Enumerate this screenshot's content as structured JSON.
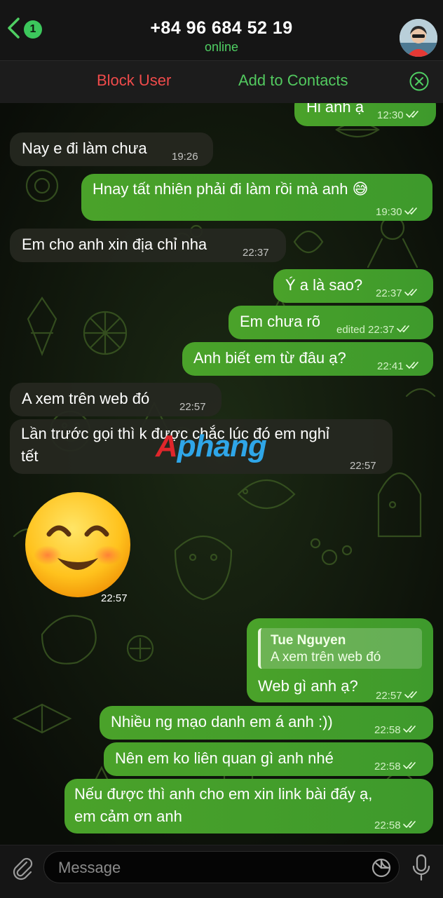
{
  "header": {
    "back_badge": "1",
    "title": "+84 96 684 52 19",
    "status": "online"
  },
  "action_bar": {
    "block": "Block User",
    "add": "Add to Contacts"
  },
  "messages": [
    {
      "text": "Hi anh ạ",
      "time": "12:30",
      "dir": "out"
    },
    {
      "text": "Nay e đi làm chưa",
      "time": "19:26",
      "dir": "in"
    },
    {
      "text": "Hnay tất nhiên phải đi làm rồi mà anh 😅",
      "time": "19:30",
      "dir": "out"
    },
    {
      "text": "Em cho anh xin địa chỉ nha",
      "time": "22:37",
      "dir": "in"
    },
    {
      "text": "Ý a là sao?",
      "time": "22:37",
      "dir": "out"
    },
    {
      "text": "Em chưa rõ",
      "edited": "edited",
      "time": "22:37",
      "dir": "out"
    },
    {
      "text": "Anh biết em từ đâu ạ?",
      "time": "22:41",
      "dir": "out"
    },
    {
      "text": "A xem trên web đó",
      "time": "22:57",
      "dir": "in"
    },
    {
      "line1": "Lần trước gọi thì k được chắc lúc đó em nghỉ",
      "line2": "tết",
      "time": "22:57",
      "dir": "in"
    },
    {
      "emoji": "smiling-face-emoji",
      "time": "22:57",
      "dir": "in"
    },
    {
      "reply_name": "Tue Nguyen",
      "reply_text": "A xem trên web đó",
      "text": "Web gì anh ạ?",
      "time": "22:57",
      "dir": "out"
    },
    {
      "text": "Nhiều ng mạo danh em á anh :))",
      "time": "22:58",
      "dir": "out"
    },
    {
      "text": "Nên em ko liên quan gì anh nhé",
      "time": "22:58",
      "dir": "out"
    },
    {
      "line1": "Nếu được thì anh cho em xin link bài đấy ạ,",
      "line2": "em cảm ơn anh",
      "time": "22:58",
      "dir": "out"
    }
  ],
  "watermark": {
    "a": "A",
    "rest": "phang"
  },
  "input": {
    "placeholder": "Message"
  },
  "colors": {
    "outgoing_bubble": "#45a02b",
    "incoming_bubble": "#262820",
    "accent_green": "#4fcf63",
    "block_red": "#f04b4b"
  },
  "icons": [
    "back-chevron-icon",
    "close-circle-icon",
    "attach-paperclip-icon",
    "sticker-icon",
    "microphone-icon",
    "double-check-icon"
  ]
}
